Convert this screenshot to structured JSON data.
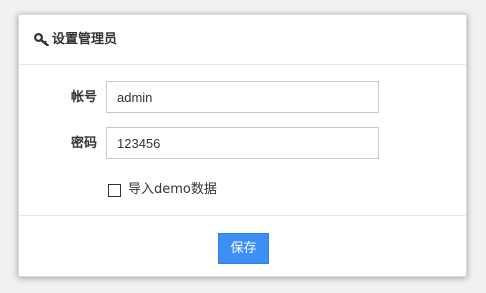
{
  "dialog": {
    "title": "设置管理员",
    "title_icon": "key-icon"
  },
  "form": {
    "account_label": "帐号",
    "account_value": "admin",
    "password_label": "密码",
    "password_value": "123456",
    "import_demo_label": "导入demo数据",
    "import_demo_checked": false
  },
  "footer": {
    "save_label": "保存"
  },
  "colors": {
    "primary_button": "#3d8ff4",
    "text": "#333333",
    "border": "#c9c9c9"
  }
}
